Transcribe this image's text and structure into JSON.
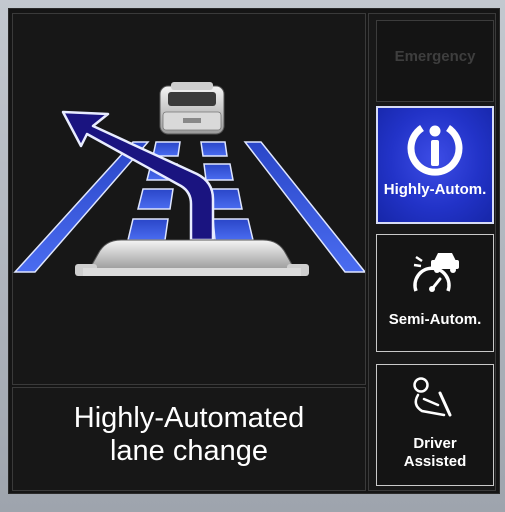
{
  "status": {
    "line1": "Highly-Automated",
    "line2": "lane change"
  },
  "modes": [
    {
      "label": "Emergency",
      "state": "inactive"
    },
    {
      "label": "Highly-Autom.",
      "state": "active"
    },
    {
      "label": "Semi-Autom.",
      "state": "available"
    },
    {
      "label_line1": "Driver",
      "label_line2": "Assisted",
      "state": "available"
    }
  ],
  "colors": {
    "active_mode": "#2233c8",
    "lane_blue": "#3a5ae0",
    "maneuver_path": "#1a1480"
  },
  "icons": {
    "lane_change_arrow": "lane-change-arrow-icon",
    "highly_automated": "automation-i-icon",
    "semi_automated": "speedometer-car-icon",
    "driver_assisted": "driver-steering-icon"
  }
}
